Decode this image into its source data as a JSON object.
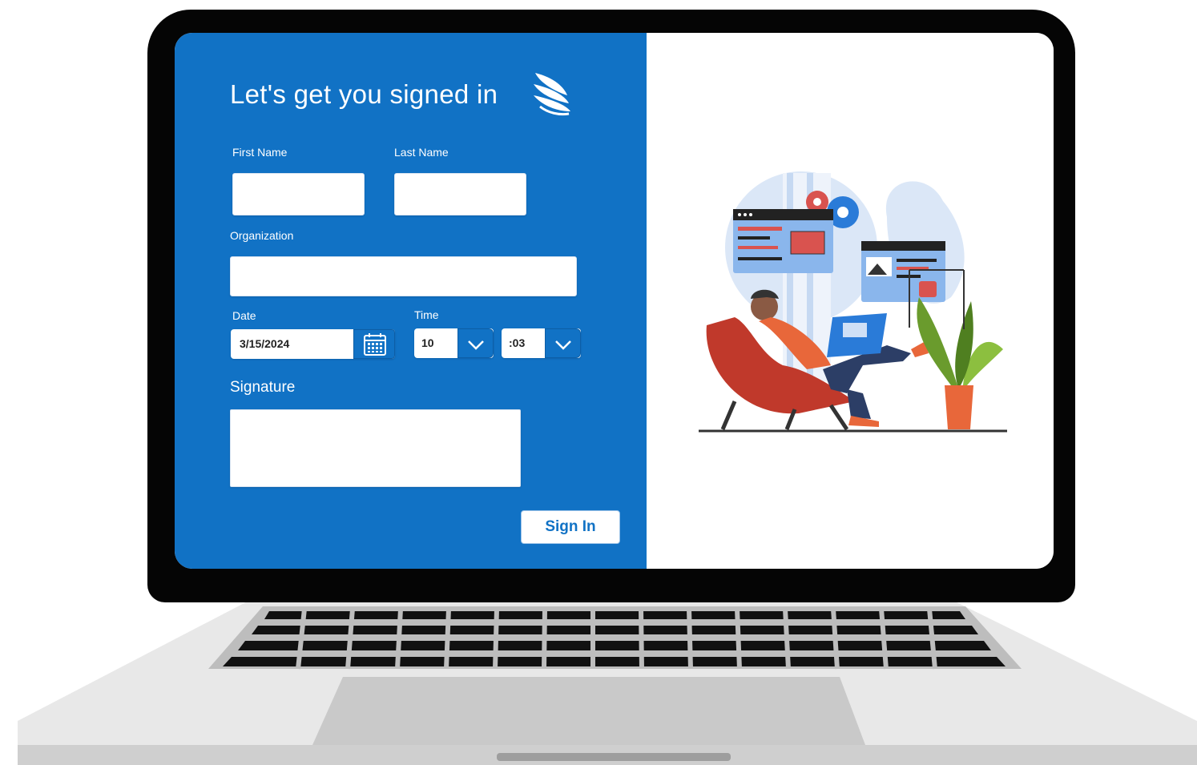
{
  "form": {
    "title": "Let's get you signed in",
    "first_name_label": "First Name",
    "last_name_label": "Last Name",
    "first_name_value": "",
    "last_name_value": "",
    "organization_label": "Organization",
    "organization_value": "",
    "date_label": "Date",
    "date_value": "3/15/2024",
    "time_label": "Time",
    "hour_value": "10",
    "minute_value": ":03",
    "signature_label": "Signature",
    "signin_label": "Sign In"
  },
  "icons": {
    "logo": "wing-logo-icon",
    "calendar": "calendar-icon",
    "dropdown": "chevron-down-icon"
  },
  "colors": {
    "panel_blue": "#1172c5",
    "laptop_bezel": "#050505",
    "keyboard_deck": "#e6e6e6"
  }
}
